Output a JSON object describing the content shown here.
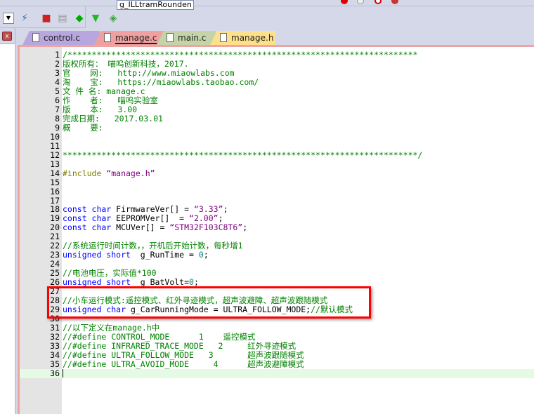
{
  "toolbar": {
    "symbol_combo": "g_ILLtramRounden",
    "icons": [
      "indent-icon",
      "unindent-icon",
      "bookmark-icon",
      "open-folder-icon",
      "find-icon",
      "breakpoint-icon",
      "run-icon",
      "stop-icon",
      "config-icon"
    ],
    "second_row_icons": [
      "dropdown-icon",
      "wizard-icon",
      "build-icon",
      "batch-icon",
      "rebuild-icon",
      "filter-icon",
      "load-icon"
    ]
  },
  "tabs": [
    {
      "label": "control.c",
      "color": "#b8a6de",
      "active": false
    },
    {
      "label": "manage.c",
      "color": "#f0a0a0",
      "active": true
    },
    {
      "label": "main.c",
      "color": "#c4d4a8",
      "active": false
    },
    {
      "label": "manage.h",
      "color": "#fde08a",
      "active": false
    }
  ],
  "colors": {
    "comment": "#008000",
    "keyword": "#0000ff",
    "string": "#800080",
    "preprocessor": "#808000",
    "number": "#008080",
    "highlight_box": "#ff0000"
  },
  "editor": {
    "current_line": 36,
    "lines": [
      [
        [
          "c",
          "/************************************************************************"
        ]
      ],
      [
        [
          "c",
          "版权所有： 喵呜创新科技，2017."
        ]
      ],
      [
        [
          "c",
          "官    网:   http://www.miaowlabs.com"
        ]
      ],
      [
        [
          "c",
          "淘    宝:   https://miaowlabs.taobao.com/"
        ]
      ],
      [
        [
          "c",
          "文 件 名: manage.c"
        ]
      ],
      [
        [
          "c",
          "作    者:   喵呜实验室"
        ]
      ],
      [
        [
          "c",
          "版    本:   3.00"
        ]
      ],
      [
        [
          "c",
          "完成日期:   2017.03.01"
        ]
      ],
      [
        [
          "c",
          "概    要:"
        ]
      ],
      [],
      [],
      [
        [
          "c",
          "*************************************************************************/"
        ]
      ],
      [],
      [
        [
          "p",
          "#include "
        ],
        [
          "s",
          "“manage.h”"
        ]
      ],
      [],
      [],
      [],
      [
        [
          "k",
          "const char "
        ],
        [
          "t",
          "FirmwareVer[] = "
        ],
        [
          "s",
          "“3.33”"
        ],
        [
          "t",
          ";"
        ]
      ],
      [
        [
          "k",
          "const char "
        ],
        [
          "t",
          "EEPROMVer[]  = "
        ],
        [
          "s",
          "“2.00”"
        ],
        [
          "t",
          ";"
        ]
      ],
      [
        [
          "k",
          "const char "
        ],
        [
          "t",
          "MCUVer[] = "
        ],
        [
          "s",
          "“STM32F103C8T6”"
        ],
        [
          "t",
          ";"
        ]
      ],
      [],
      [
        [
          "c",
          "//系统运行时间计数，，开机后开始计数，每秒增1"
        ]
      ],
      [
        [
          "k",
          "unsigned short  "
        ],
        [
          "t",
          "g_RunTime = "
        ],
        [
          "n",
          "0"
        ],
        [
          "t",
          ";"
        ]
      ],
      [],
      [
        [
          "c",
          "//电池电压，实际值*100"
        ]
      ],
      [
        [
          "k",
          "unsigned short  "
        ],
        [
          "t",
          "g_BatVolt="
        ],
        [
          "n",
          "0"
        ],
        [
          "t",
          ";"
        ]
      ],
      [],
      [
        [
          "c",
          "//小车运行模式:遥控模式、红外寻迹模式，超声波避障、超声波跟随模式"
        ]
      ],
      [
        [
          "k",
          "unsigned char "
        ],
        [
          "t",
          "g_CarRunningMode = ULTRA_FOLLOW_MODE;"
        ],
        [
          "c",
          "//默认模式"
        ]
      ],
      [],
      [
        [
          "c",
          "//以下定义在manage.h中"
        ]
      ],
      [
        [
          "c",
          "//#define CONTROL_MODE      1    遥控模式"
        ]
      ],
      [
        [
          "c",
          "//#define INFRARED_TRACE_MODE   2     红外寻迹模式"
        ]
      ],
      [
        [
          "c",
          "//#define ULTRA_FOLLOW_MODE   3       超声波跟随模式"
        ]
      ],
      [
        [
          "c",
          "//#define ULTRA_AVOID_MODE     4      超声波避障模式"
        ]
      ],
      []
    ]
  }
}
